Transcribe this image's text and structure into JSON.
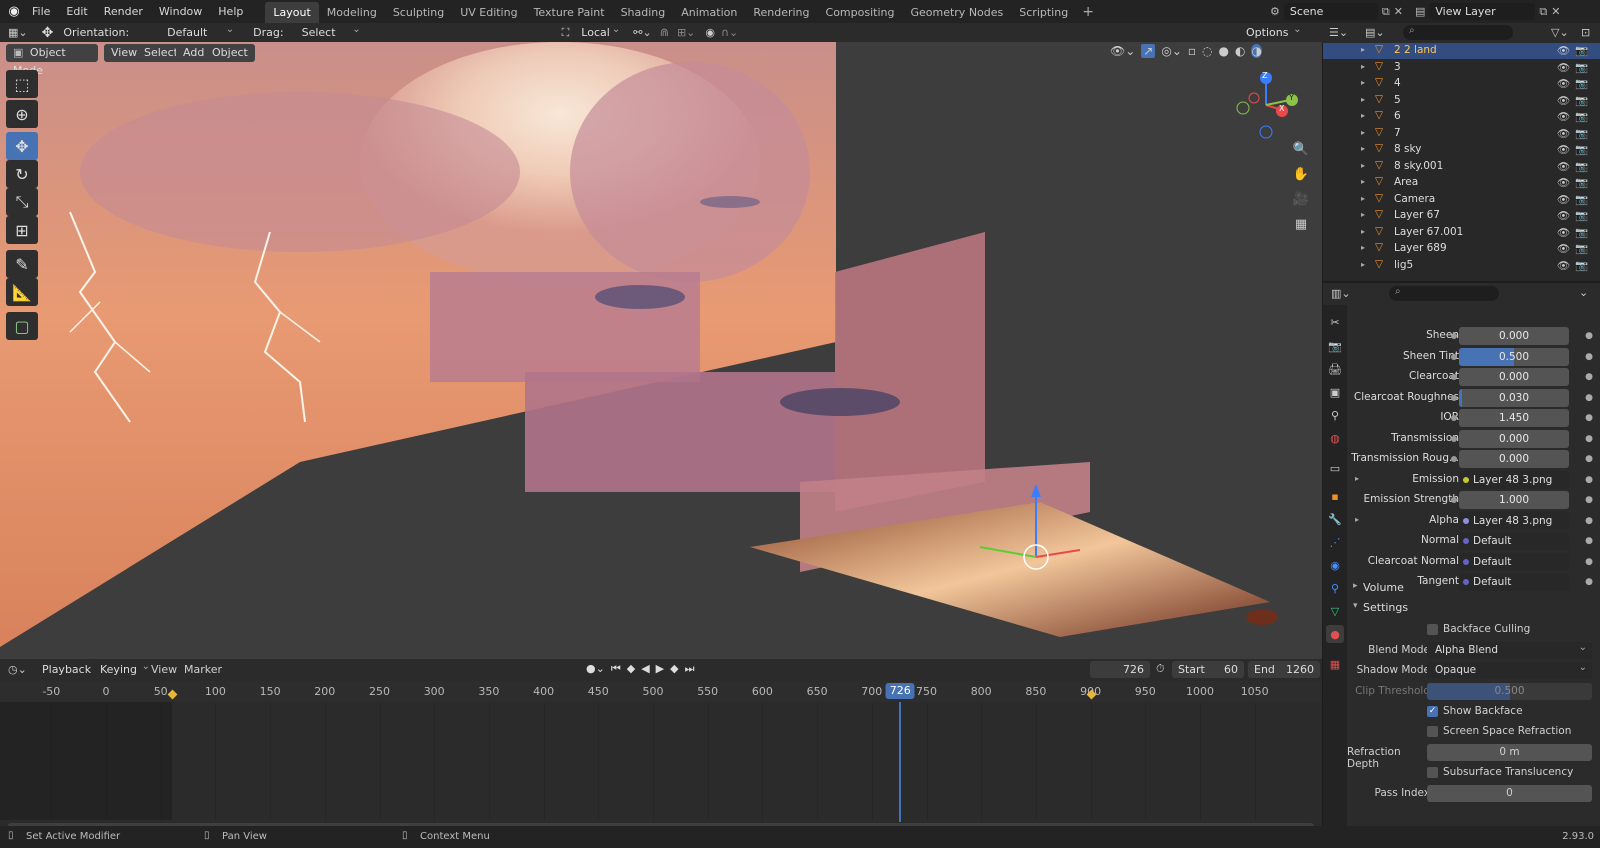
{
  "topbar": {
    "menus": [
      "File",
      "Edit",
      "Render",
      "Window",
      "Help"
    ],
    "workspaces": [
      "Layout",
      "Modeling",
      "Sculpting",
      "UV Editing",
      "Texture Paint",
      "Shading",
      "Animation",
      "Rendering",
      "Compositing",
      "Geometry Nodes",
      "Scripting"
    ],
    "active_workspace": "Layout",
    "scene": "Scene",
    "view_layer": "View Layer"
  },
  "header": {
    "orientation_label": "Orientation:",
    "orientation_value": "Default",
    "drag_label": "Drag:",
    "drag_value": "Select Box",
    "pivot_value": "Local",
    "options_label": "Options"
  },
  "viewport": {
    "mode": "Object Mode",
    "menus": [
      "View",
      "Select",
      "Add",
      "Object"
    ],
    "gizmo_axes": [
      "Z",
      "X",
      "Y"
    ]
  },
  "outliner": {
    "rows": [
      {
        "name": "2 2 land",
        "selected": true
      },
      {
        "name": "3"
      },
      {
        "name": "4"
      },
      {
        "name": "5"
      },
      {
        "name": "6"
      },
      {
        "name": "7"
      },
      {
        "name": "8 sky"
      },
      {
        "name": "8 sky.001"
      },
      {
        "name": "Area"
      },
      {
        "name": "Camera"
      },
      {
        "name": "Layer 67"
      },
      {
        "name": "Layer 67.001"
      },
      {
        "name": "Layer 689"
      },
      {
        "name": "lig5"
      }
    ]
  },
  "properties": {
    "rows": [
      {
        "label": "Sheen",
        "value": "0.000",
        "type": "num"
      },
      {
        "label": "Sheen Tint",
        "value": "0.500",
        "type": "num",
        "fill": 0.5
      },
      {
        "label": "Clearcoat",
        "value": "0.000",
        "type": "num"
      },
      {
        "label": "Clearcoat Roughnes",
        "value": "0.030",
        "type": "num",
        "fill": 0.03
      },
      {
        "label": "IOR",
        "value": "1.450",
        "type": "num"
      },
      {
        "label": "Transmission",
        "value": "0.000",
        "type": "num"
      },
      {
        "label": "Transmission Roug...",
        "value": "0.000",
        "type": "num"
      },
      {
        "label": "Emission",
        "value": "Layer 48 3.png",
        "type": "link",
        "dot": "#c7c729",
        "expand": true
      },
      {
        "label": "Emission Strength",
        "value": "1.000",
        "type": "num"
      },
      {
        "label": "Alpha",
        "value": "Layer 48 3.png",
        "type": "link",
        "dot": "#8f8fdf",
        "expand": true
      },
      {
        "label": "Normal",
        "value": "Default",
        "type": "link",
        "dot": "#6363c7"
      },
      {
        "label": "Clearcoat Normal",
        "value": "Default",
        "type": "link",
        "dot": "#6363c7"
      },
      {
        "label": "Tangent",
        "value": "Default",
        "type": "link",
        "dot": "#6363c7"
      }
    ],
    "panels": [
      "Volume",
      "Settings"
    ],
    "settings": {
      "backface_culling": "Backface Culling",
      "blend_mode_label": "Blend Mode",
      "blend_mode": "Alpha Blend",
      "shadow_mode_label": "Shadow Mode",
      "shadow_mode": "Opaque",
      "clip_threshold_label": "Clip Threshold",
      "clip_threshold": "0.500",
      "show_backface": "Show Backface",
      "ssr": "Screen Space Refraction",
      "refraction_depth_label": "Refraction Depth",
      "refraction_depth": "0 m",
      "subsurface": "Subsurface Translucency",
      "pass_index_label": "Pass Index",
      "pass_index": "0"
    }
  },
  "timeline": {
    "menus": [
      "Playback",
      "Keying",
      "View",
      "Marker"
    ],
    "current_frame": "726",
    "start_label": "Start",
    "start": "60",
    "end_label": "End",
    "end": "1260",
    "ticks": [
      "-50",
      "0",
      "50",
      "100",
      "150",
      "200",
      "250",
      "300",
      "350",
      "400",
      "450",
      "500",
      "550",
      "600",
      "650",
      "700",
      "750",
      "800",
      "850",
      "900",
      "950",
      "1000",
      "1050"
    ],
    "keyframes": [
      60,
      900
    ]
  },
  "status": {
    "left": "Set Active Modifier",
    "middle": "Pan View",
    "right": "Context Menu",
    "version": "2.93.0"
  },
  "colors": {
    "accent": "#4772b3",
    "selected_row": "#334d80",
    "keyframe": "#e8b63a"
  }
}
